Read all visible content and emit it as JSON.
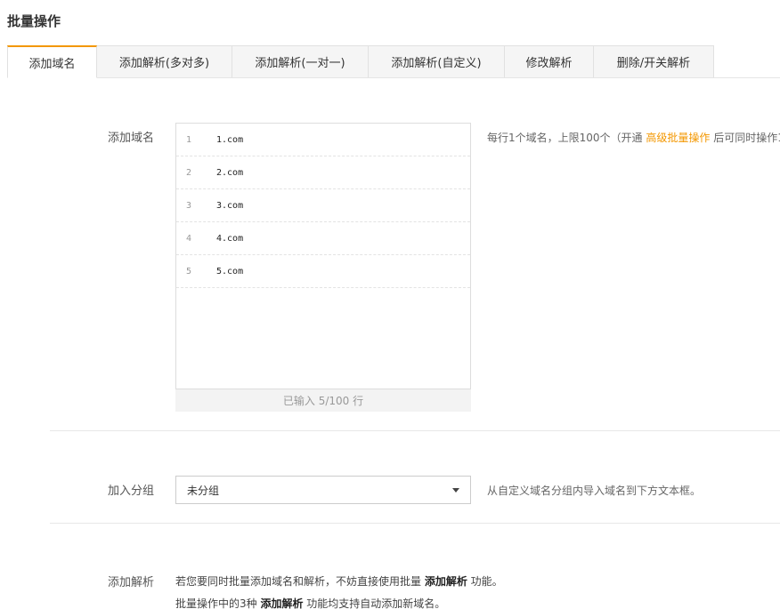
{
  "page": {
    "title": "批量操作"
  },
  "tabs": [
    {
      "label": "添加域名",
      "active": true
    },
    {
      "label": "添加解析(多对多)",
      "active": false
    },
    {
      "label": "添加解析(一对一)",
      "active": false
    },
    {
      "label": "添加解析(自定义)",
      "active": false
    },
    {
      "label": "修改解析",
      "active": false
    },
    {
      "label": "删除/开关解析",
      "active": false
    }
  ],
  "add_domain": {
    "label": "添加域名",
    "lines": [
      {
        "num": "1",
        "text": "1.com"
      },
      {
        "num": "2",
        "text": "2.com"
      },
      {
        "num": "3",
        "text": "3.com"
      },
      {
        "num": "4",
        "text": "4.com"
      },
      {
        "num": "5",
        "text": "5.com"
      }
    ],
    "counter": "已输入 5/100 行",
    "hint_prefix": "每行1个域名，上限100个（开通 ",
    "hint_link": "高级批量操作",
    "hint_suffix": " 后可同时操作1"
  },
  "group": {
    "label": "加入分组",
    "selected": "未分组",
    "hint": "从自定义域名分组内导入域名到下方文本框。"
  },
  "add_record": {
    "label": "添加解析",
    "line1_a": "若您要同时批量添加域名和解析，不妨直接使用批量 ",
    "line1_b": "添加解析",
    "line1_c": " 功能。",
    "line2_a": "批量操作中的3种 ",
    "line2_b": "添加解析",
    "line2_c": " 功能均支持自动添加新域名。"
  },
  "colors": {
    "accent": "#f39700",
    "tab_bg": "#f5f5f5",
    "border": "#e1e1e1"
  }
}
